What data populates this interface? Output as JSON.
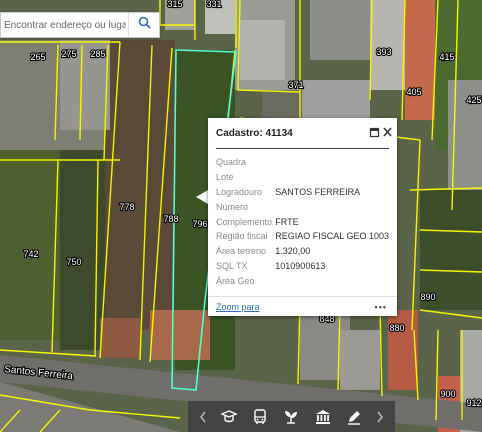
{
  "search": {
    "placeholder": "Encontrar endereço ou lugar"
  },
  "map_labels": {
    "lots": [
      "315",
      "331",
      "265",
      "275",
      "285",
      "393",
      "371",
      "405",
      "415",
      "425",
      "778",
      "788",
      "796",
      "742",
      "750",
      "890",
      "848",
      "880",
      "900",
      "912"
    ],
    "street": "Santos Ferreira"
  },
  "popup": {
    "title": "Cadastro: 41134",
    "rows": [
      {
        "key": "Quadra",
        "value": ""
      },
      {
        "key": "Lote",
        "value": ""
      },
      {
        "key": "Logradouro",
        "value": "SANTOS FERREIRA"
      },
      {
        "key": "Número",
        "value": ""
      },
      {
        "key": "Complemento",
        "value": "FRTE"
      },
      {
        "key": "Região fiscal",
        "value": "REGIAO FISCAL GEO 1003"
      },
      {
        "key": "Área terreno",
        "value": "1.320,00"
      },
      {
        "key": "SQL TX",
        "value": "1010900613"
      },
      {
        "key": "Área Geo",
        "value": ""
      }
    ],
    "zoom_label": "Zoom para",
    "more_label": "•••"
  },
  "toolbar": {
    "tools": [
      "education-icon",
      "bus-icon",
      "plant-icon",
      "museum-icon",
      "edit-icon"
    ]
  },
  "colors": {
    "parcel_border": "#f5f500",
    "selected_parcel": "#4dffd2",
    "link": "#2e6fb7"
  }
}
